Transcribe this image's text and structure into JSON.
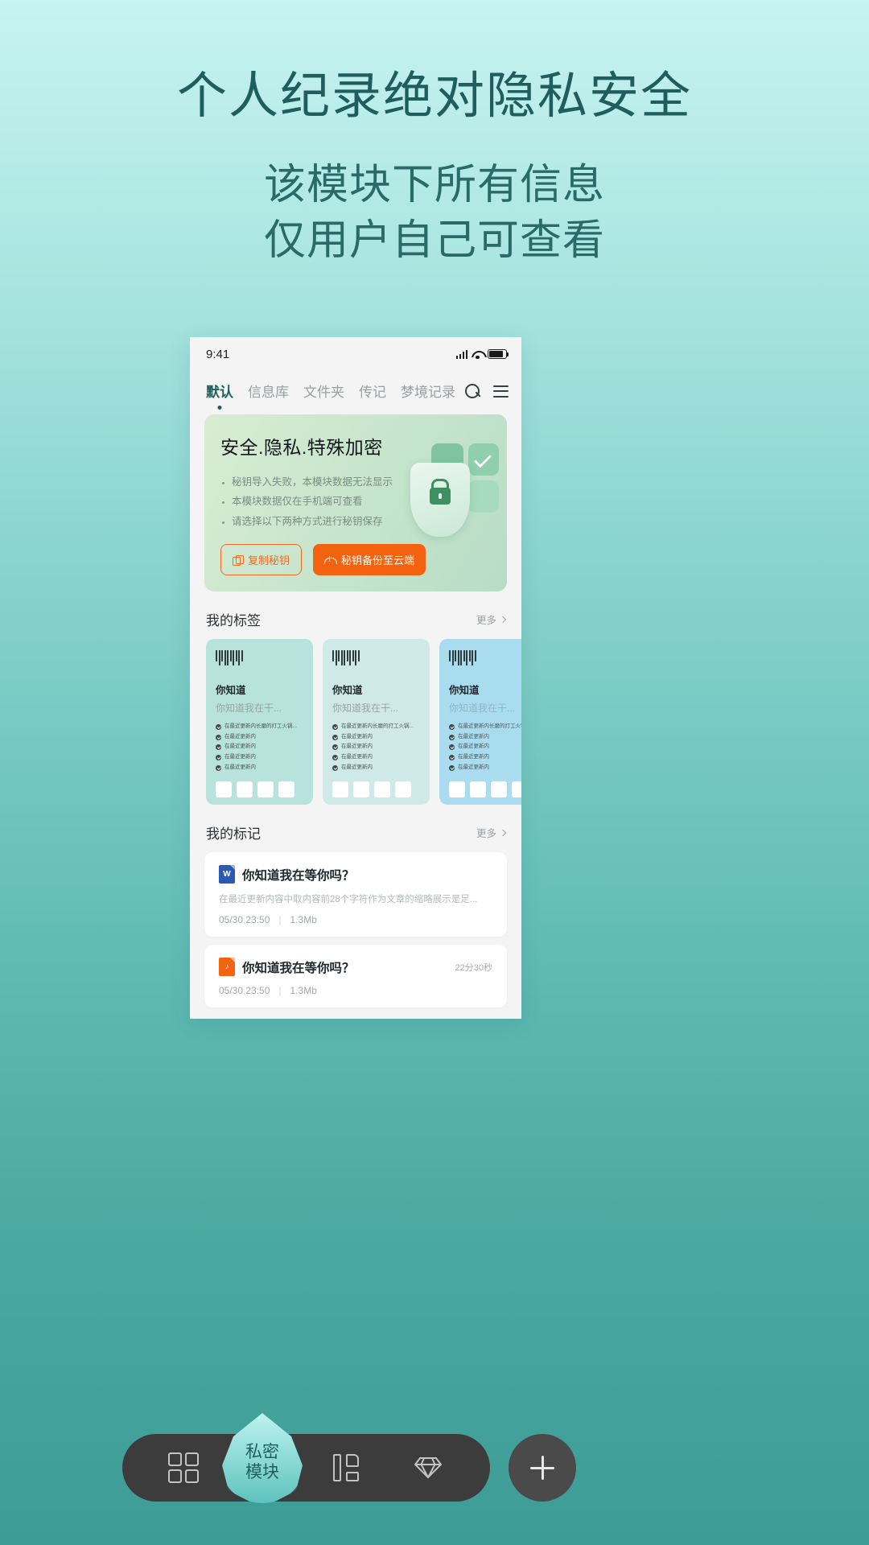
{
  "headline": {
    "main": "个人纪录绝对隐私安全",
    "sub_line1": "该模块下所有信息",
    "sub_line2": "仅用户自己可查看"
  },
  "phone": {
    "statusbar": {
      "time": "9:41",
      "signal_icon": "signal-bars-icon",
      "wifi_icon": "wifi-icon",
      "battery_icon": "battery-icon"
    },
    "tabs": [
      {
        "label": "默认",
        "active": true
      },
      {
        "label": "信息库",
        "active": false
      },
      {
        "label": "文件夹",
        "active": false
      },
      {
        "label": "传记",
        "active": false
      },
      {
        "label": "梦境记录",
        "active": false
      }
    ],
    "tabbar_actions": [
      {
        "name": "search-icon"
      },
      {
        "name": "menu-icon"
      }
    ],
    "security_card": {
      "title": "安全.隐私.特殊加密",
      "bullets": [
        "秘钥导入失败，本模块数据无法显示",
        "本模块数据仅在手机端可查看",
        "请选择以下两种方式进行秘钥保存"
      ],
      "buttons": [
        {
          "label": "复制秘钥",
          "icon": "copy-icon",
          "style": "ghost",
          "color": "#f26a21"
        },
        {
          "label": "秘钥备份至云端",
          "icon": "cloud-upload-icon",
          "style": "solid",
          "color": "#f2620f"
        }
      ],
      "graphic": "shield-lock-icon"
    },
    "tags_section": {
      "title": "我的标签",
      "more_label": "更多",
      "cards": [
        {
          "title": "你知道",
          "subtitle": "你知道我在干...",
          "items": [
            "在最近更新内长磨的打工火锅...",
            "在最近更新内",
            "在最近更新内",
            "在最近更新内",
            "在最近更新内"
          ]
        },
        {
          "title": "你知道",
          "subtitle": "你知道我在干...",
          "items": [
            "在最近更新内长磨的打工火锅...",
            "在最近更新内",
            "在最近更新内",
            "在最近更新内",
            "在最近更新内"
          ]
        },
        {
          "title": "你知道",
          "subtitle": "你知道我在干...",
          "items": [
            "在最近更新内长磨的打工火锅...",
            "在最近更新内",
            "在最近更新内",
            "在最近更新内",
            "在最近更新内"
          ]
        }
      ]
    },
    "marks_section": {
      "title": "我的标记",
      "more_label": "更多",
      "items": [
        {
          "file_type": "word",
          "file_letter": "W",
          "title": "你知道我在等你吗？",
          "duration": "",
          "description": "在最近更新内容中取内容前28个字符作为文章的缩略展示是足...",
          "date": "05/30 23:50",
          "size": "1.3Mb"
        },
        {
          "file_type": "audio",
          "file_letter": "♪",
          "title": "你知道我在等你吗？",
          "duration": "22分30秒",
          "description": "",
          "date": "05/30 23:50",
          "size": "1.3Mb"
        }
      ]
    }
  },
  "dock": {
    "items": [
      {
        "name": "grid-icon",
        "label": ""
      },
      {
        "name": "library-icon",
        "label": ""
      },
      {
        "name": "diamond-icon",
        "label": ""
      }
    ],
    "center": {
      "label_line1": "私密",
      "label_line2": "模块",
      "icon": "droplet-icon"
    },
    "fab": {
      "name": "plus-icon"
    }
  },
  "colors": {
    "accent_orange": "#f2620f",
    "teal_dark": "#1f5e5c",
    "card_green": "#c8e6cd"
  }
}
